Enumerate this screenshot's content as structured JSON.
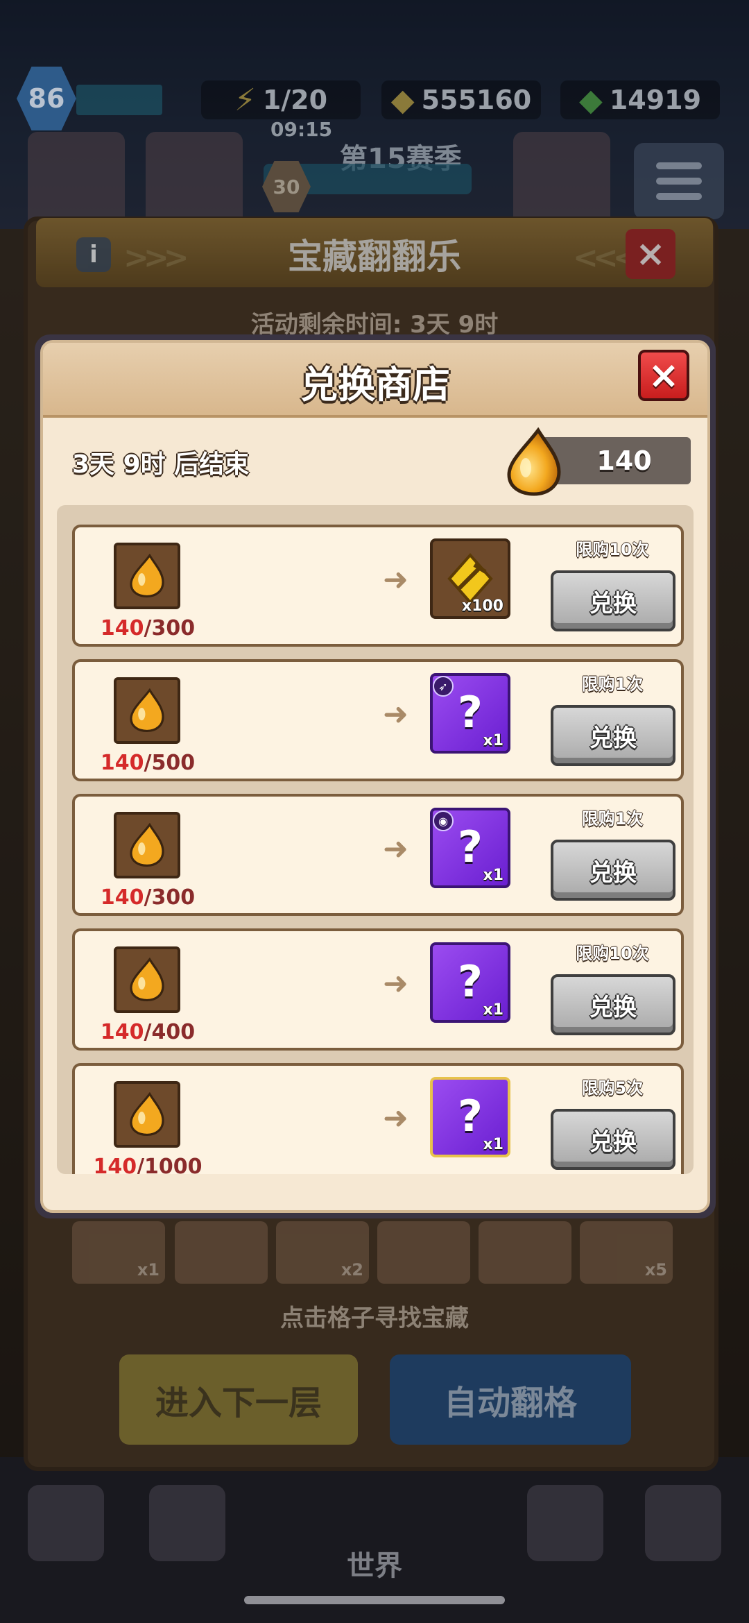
{
  "background": {
    "level": "86",
    "energy": "1/20",
    "energy_timer": "09:15",
    "gold": "555160",
    "gems": "14919",
    "season_label": "第15赛季",
    "season_level": "30",
    "event_title": "宝藏翻翻乐",
    "event_timer": "活动剩余时间: 3天 9时",
    "slot_labels": [
      "x1",
      "x2",
      "x5"
    ],
    "find_hint": "点击格子寻找宝藏",
    "next_floor_label": "进入下一层",
    "auto_flip_label": "自动翻格",
    "nav_world_label": "世界"
  },
  "shop": {
    "title": "兑换商店",
    "end_text": "3天 9时 后结束",
    "balance": "140",
    "close_icon": "close-icon",
    "exchange_label": "兑换",
    "items": [
      {
        "have": "140",
        "need": "/300",
        "reward_qty": "x100",
        "reward_icon": "gold-pickaxe-icon",
        "limit": "限购10次",
        "rarity": "gold"
      },
      {
        "have": "140",
        "need": "/500",
        "reward_qty": "x1",
        "reward_icon": "mystery-bow-icon",
        "limit": "限购1次",
        "rarity": "purple"
      },
      {
        "have": "140",
        "need": "/300",
        "reward_qty": "x1",
        "reward_icon": "mystery-belt-icon",
        "limit": "限购1次",
        "rarity": "purple"
      },
      {
        "have": "140",
        "need": "/400",
        "reward_qty": "x1",
        "reward_icon": "mystery-fragment-icon",
        "limit": "限购10次",
        "rarity": "purple"
      },
      {
        "have": "140",
        "need": "/1000",
        "reward_qty": "x1",
        "reward_icon": "mystery-fragment-icon",
        "limit": "限购5次",
        "rarity": "purple-gold"
      }
    ]
  },
  "colors": {
    "accent_red": "#d52a2a",
    "close_red": "#e33434",
    "panel_cream": "#f6e8d3",
    "purple_rarity": "#7b2ee0"
  }
}
